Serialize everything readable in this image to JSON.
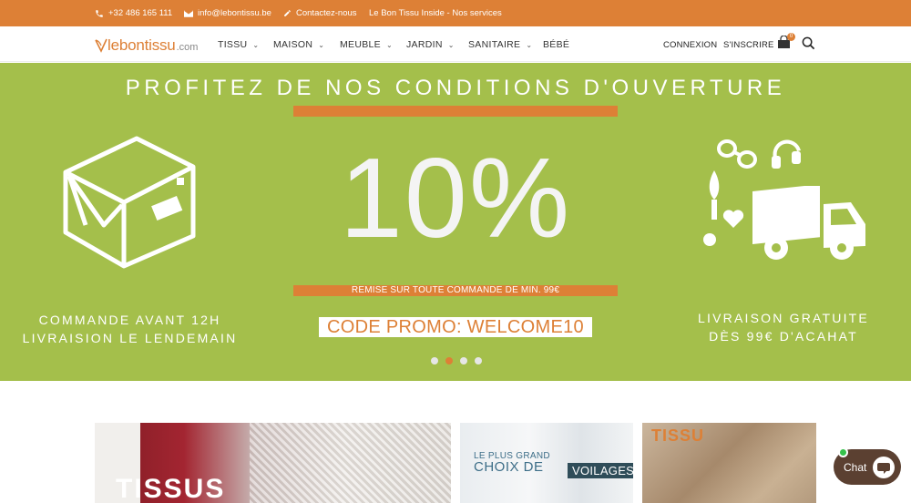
{
  "topbar": {
    "phone": "+32 486 165 111",
    "email": "info@lebontissu.be",
    "contact": "Contactez-nous",
    "inside": "Le Bon Tissu Inside - Nos services"
  },
  "logo": {
    "word": "lebontissu",
    "suffix": ".com"
  },
  "nav": {
    "items": [
      {
        "label": "TISSU",
        "has_menu": true
      },
      {
        "label": "MAISON",
        "has_menu": true
      },
      {
        "label": "MEUBLE",
        "has_menu": true
      },
      {
        "label": "JARDIN",
        "has_menu": true
      },
      {
        "label": "SANITAIRE",
        "has_menu": true
      },
      {
        "label": "BÉBÉ",
        "has_menu": false
      }
    ],
    "login": "CONNEXION",
    "register": "S'INSCRIRE",
    "cart_count": "0"
  },
  "hero": {
    "title": "PROFITEZ DE NOS CONDITIONS D'OUVERTURE",
    "percent": "10%",
    "remise": "REMISE SUR TOUTE COMMANDE DE MIN. 99€",
    "code": "CODE PROMO: WELCOME10",
    "left_line1": "COMMANDE AVANT 12H",
    "left_line2": "LIVRAISION LE LENDEMAIN",
    "right_line1": "LIVRAISON GRATUITE",
    "right_line2": "DÈS 99€ D'ACAHAT",
    "slides": 4,
    "active_slide": 2
  },
  "tiles": {
    "tissus": "TISSUS",
    "voilages_line1": "LE PLUS GRAND",
    "voilages_line2": "CHOIX DE",
    "voilages_tag": "VOILAGES",
    "tissu_small": "TISSU"
  },
  "chat": {
    "label": "Chat"
  },
  "colors": {
    "brand_orange": "#dd8036",
    "hero_green": "#a4bf4b",
    "chat_brown": "#5b4031"
  }
}
